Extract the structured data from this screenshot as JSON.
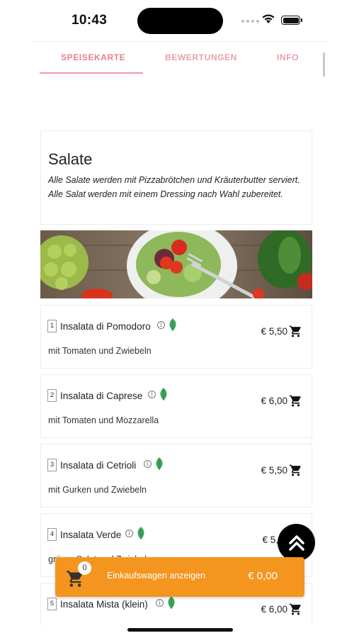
{
  "status_bar": {
    "time": "10:43"
  },
  "tabs": [
    {
      "label": "SPEISEKARTE"
    },
    {
      "label": "BEWERTUNGEN"
    },
    {
      "label": "INFO"
    }
  ],
  "category": {
    "title": "Salate",
    "description": "Alle Salate werden mit Pizzabrötchen und Kräuterbutter serviert. Alle Salat werden mit einem Dressing nach Wahl zubereitet."
  },
  "items": [
    {
      "number": "1",
      "name": "Insalata di Pomodoro",
      "description": "mit Tomaten und Zwiebeln",
      "price": "€ 5,50",
      "icons": [
        "info-icon",
        "leaf-icon",
        "cart-icon"
      ]
    },
    {
      "number": "2",
      "name": "Insalata di Caprese",
      "description": "mit Tomaten und Mozzarella",
      "price": "€ 6,00",
      "icons": [
        "info-icon",
        "leaf-icon",
        "cart-icon"
      ]
    },
    {
      "number": "3",
      "name": "Insalata di Cetrioli",
      "description": "mit Gurken und Zwiebeln",
      "price": "€ 5,50",
      "icons": [
        "info-icon",
        "leaf-icon",
        "cart-icon"
      ]
    },
    {
      "number": "4",
      "name": "Insalata Verde",
      "description": "grüner Salat und Zwiebeln",
      "price": "€ 5,",
      "icons": [
        "info-icon",
        "leaf-icon"
      ]
    },
    {
      "number": "5",
      "name": "Insalata Mista (klein)",
      "description": "",
      "price": "€ 6,00",
      "icons": [
        "info-icon",
        "leaf-icon",
        "cart-icon"
      ]
    }
  ],
  "scroll_top": {
    "icon": "double-chevron-up-icon"
  },
  "cart": {
    "count": "0",
    "label": "Einkaufswagen anzeigen",
    "total": "€ 0,00",
    "icon": "shopping-cart-icon"
  },
  "colors": {
    "accent_pink": "#e88088",
    "cart_orange": "#f4951f",
    "leaf_green": "#3aa657"
  }
}
